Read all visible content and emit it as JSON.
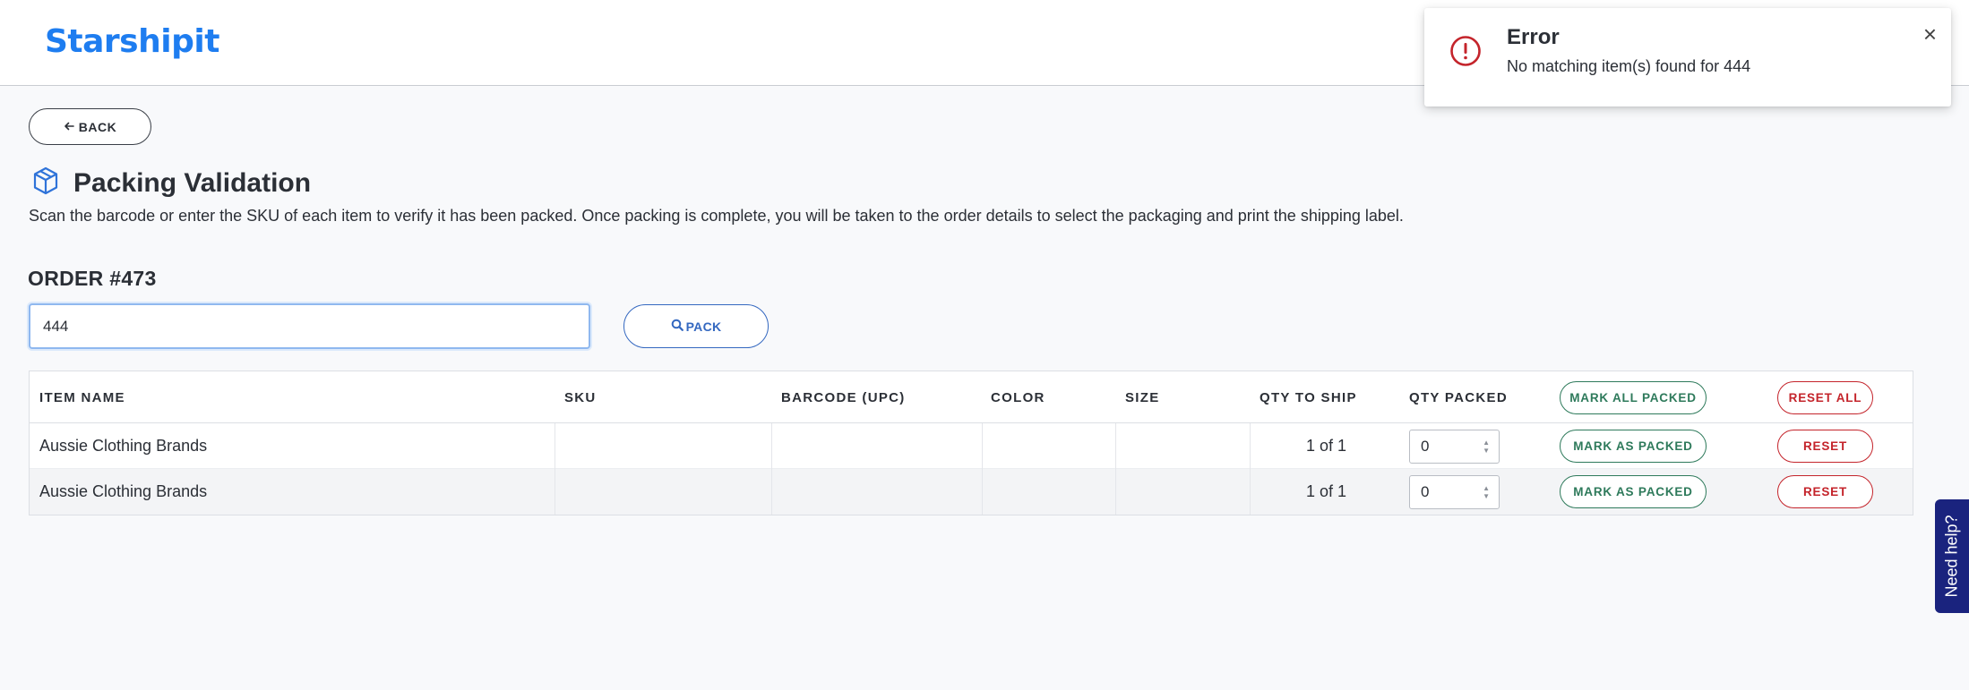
{
  "header": {
    "logo_text": "Starshipit"
  },
  "back_button": {
    "label": "BACK",
    "icon": "arrow-left-icon"
  },
  "page": {
    "title": "Packing Validation",
    "icon": "package-box-icon",
    "description": "Scan the barcode or enter the SKU of each item to verify it has been packed. Once packing is complete, you will be taken to the order details to select the packaging and print the shipping label."
  },
  "order": {
    "title": "ORDER #473"
  },
  "scan": {
    "value": "444",
    "pack_label": "PACK",
    "pack_icon": "search-icon"
  },
  "table": {
    "headers": {
      "item_name": "ITEM NAME",
      "sku": "SKU",
      "barcode": "BARCODE (UPC)",
      "color": "COLOR",
      "size": "SIZE",
      "qty_to_ship": "QTY TO SHIP",
      "qty_packed": "QTY PACKED",
      "mark_all": "MARK ALL PACKED",
      "reset_all": "RESET ALL"
    },
    "rows": [
      {
        "item_name": "Aussie Clothing Brands",
        "sku": "",
        "barcode": "",
        "color": "",
        "size": "",
        "qty_to_ship": "1 of 1",
        "qty_packed": "0",
        "mark_label": "MARK AS PACKED",
        "reset_label": "RESET"
      },
      {
        "item_name": "Aussie Clothing Brands",
        "sku": "",
        "barcode": "",
        "color": "",
        "size": "",
        "qty_to_ship": "1 of 1",
        "qty_packed": "0",
        "mark_label": "MARK AS PACKED",
        "reset_label": "RESET"
      }
    ]
  },
  "toast": {
    "title": "Error",
    "message": "No matching item(s) found for 444",
    "icon": "error-circle-icon",
    "close_icon": "close-icon"
  },
  "help": {
    "label": "Need help?"
  },
  "colors": {
    "brand": "#1e7df0",
    "primary_button": "#3468c0",
    "success": "#2e7a5b",
    "danger": "#c4242b",
    "help_tab": "#1a237e"
  }
}
